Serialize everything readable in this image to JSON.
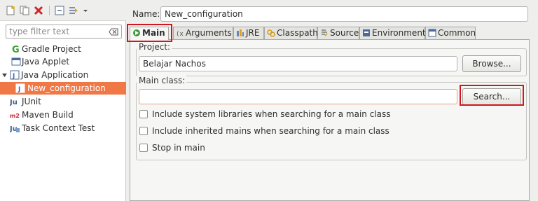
{
  "sidebar": {
    "toolbar_icons": [
      "new-config-icon",
      "duplicate-icon",
      "delete-icon",
      "collapse-all-icon",
      "filter-icon",
      "dropdown-arrow-icon"
    ],
    "filter_placeholder": "type filter text",
    "tree": [
      {
        "label": "Gradle Project",
        "icon": "gradle-icon"
      },
      {
        "label": "Java Applet",
        "icon": "java-applet-icon"
      },
      {
        "label": "Java Application",
        "icon": "java-application-icon",
        "expanded": true
      },
      {
        "label": "New_configuration",
        "icon": "java-config-icon",
        "selected": true
      },
      {
        "label": "JUnit",
        "icon": "junit-icon"
      },
      {
        "label": "Maven Build",
        "icon": "maven-icon"
      },
      {
        "label": "Task Context Test",
        "icon": "task-test-icon"
      }
    ]
  },
  "config": {
    "name_label": "Name:",
    "name_value": "New_configuration"
  },
  "tabs": [
    {
      "label": "Main",
      "icon": "main-tab-icon",
      "active": true
    },
    {
      "label": "Arguments",
      "icon": "arguments-icon"
    },
    {
      "label": "JRE",
      "icon": "jre-icon"
    },
    {
      "label": "Classpath",
      "icon": "classpath-icon"
    },
    {
      "label": "Source",
      "icon": "source-icon"
    },
    {
      "label": "Environment",
      "icon": "environment-icon"
    },
    {
      "label": "Common",
      "icon": "common-icon"
    }
  ],
  "main": {
    "project_label": "Project:",
    "project_value": "Belajar Nachos",
    "browse_label": "Browse...",
    "main_class_label": "Main class:",
    "main_class_value": "",
    "search_label": "Search...",
    "checkboxes": [
      {
        "label": "Include system libraries when searching for a main class",
        "checked": false
      },
      {
        "label": "Include inherited mains when searching for a main class",
        "checked": false
      },
      {
        "label": "Stop in main",
        "checked": false
      }
    ]
  },
  "colors": {
    "selection": "#f07746",
    "highlight_box": "#d0161e"
  }
}
